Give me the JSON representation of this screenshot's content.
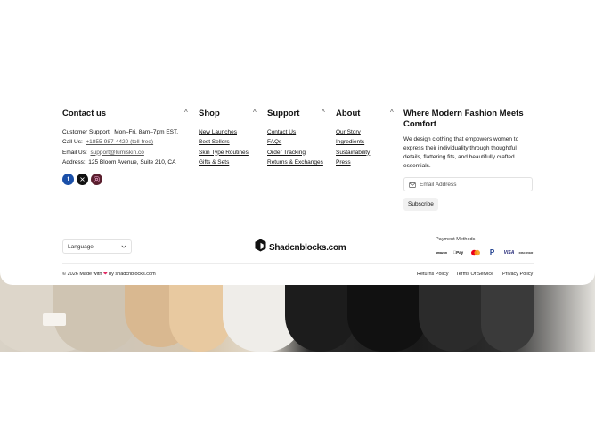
{
  "contact": {
    "title": "Contact us",
    "support_label": "Customer Support:",
    "support_value": "Mon–Fri, 8am–7pm EST.",
    "call_label": "Call Us:",
    "call_value": "+1855-987-4420 (toll-free)",
    "email_label": "Email Us:",
    "email_value": "support@lumiskin.co",
    "address_label": "Address:",
    "address_value": "125 Bloom Avenue, Suite 210, CA",
    "socials": [
      "facebook-icon",
      "x-icon",
      "instagram-icon"
    ]
  },
  "shop": {
    "title": "Shop",
    "items": [
      "New Launches",
      "Best Sellers",
      "Skin Type Routines",
      "Gifts & Sets"
    ]
  },
  "support": {
    "title": "Support",
    "items": [
      "Contact Us",
      "FAQs",
      "Order Tracking",
      "Returns & Exchanges"
    ]
  },
  "about": {
    "title": "About",
    "items": [
      "Our Story",
      "Ingredients",
      "Sustainability",
      "Press"
    ]
  },
  "newsletter": {
    "title": "Where Modern Fashion Meets Comfort",
    "description": "We design clothing that empowers women to express their individuality through thoughtful details, flattering fits, and beautifully crafted essentials.",
    "email_placeholder": "Email Address",
    "subscribe_label": "Subscribe"
  },
  "language": {
    "selected": "Language"
  },
  "brand": {
    "name": "Shadcnblocks.com"
  },
  "payment": {
    "title": "Payment Methods",
    "methods": [
      "amazon",
      "Pay",
      "mastercard",
      "PayPal",
      "VISA",
      "DISCOVER"
    ]
  },
  "copyright": {
    "prefix": "© 2026 Made with",
    "suffix": "by shadcnblocks.com"
  },
  "legal": [
    "Returns Policy",
    "Terms Of Service",
    "Privacy Policy"
  ],
  "colors": {
    "heart": "#e0245e",
    "accent": "#111111"
  }
}
